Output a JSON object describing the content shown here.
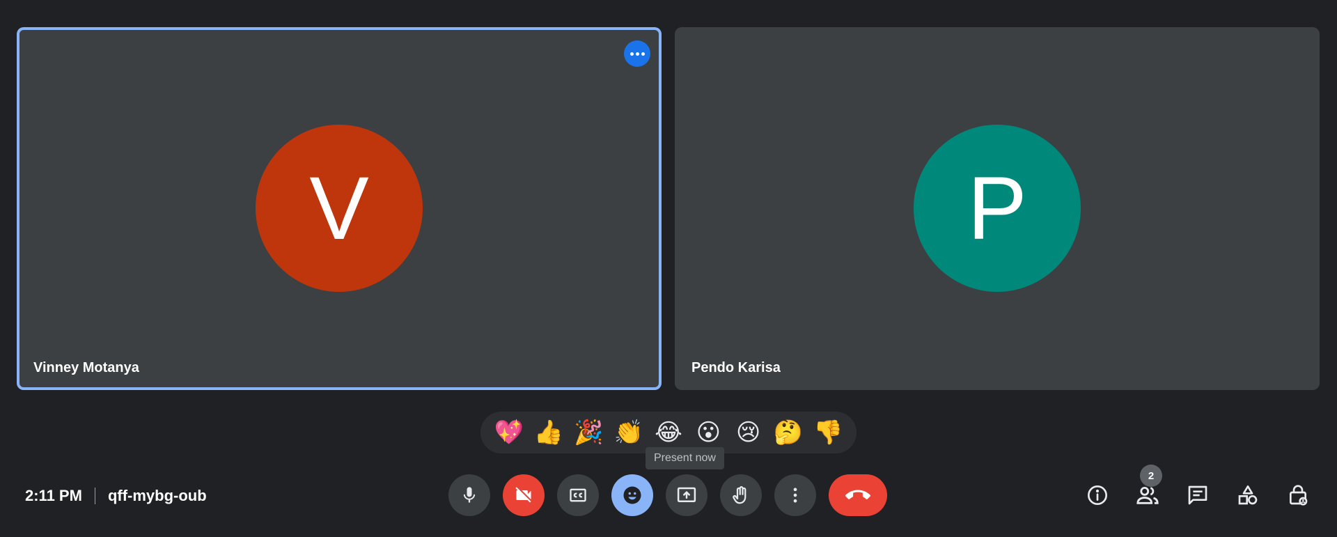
{
  "participants": [
    {
      "name": "Vinney Motanya",
      "initial": "V",
      "color": "#bf360c"
    },
    {
      "name": "Pendo Karisa",
      "initial": "P",
      "color": "#00897b"
    }
  ],
  "reactions": [
    "💖",
    "👍",
    "🎉",
    "👏",
    "😂",
    "😮",
    "😢",
    "🤔",
    "👎"
  ],
  "tooltip": "Present now",
  "meeting": {
    "time": "2:11 PM",
    "code": "qff-mybg-oub"
  },
  "people_count": "2",
  "colors": {
    "active_border": "#8ab4f8",
    "danger": "#ea4335",
    "accent": "#8ab4f8"
  },
  "icons": {
    "controls": [
      "mic-icon",
      "camera-off-icon",
      "captions-icon",
      "emoji-icon",
      "present-icon",
      "raise-hand-icon",
      "more-options-icon",
      "hang-up-icon"
    ],
    "side": [
      "info-icon",
      "people-icon",
      "chat-icon",
      "activities-icon",
      "host-controls-icon"
    ]
  }
}
